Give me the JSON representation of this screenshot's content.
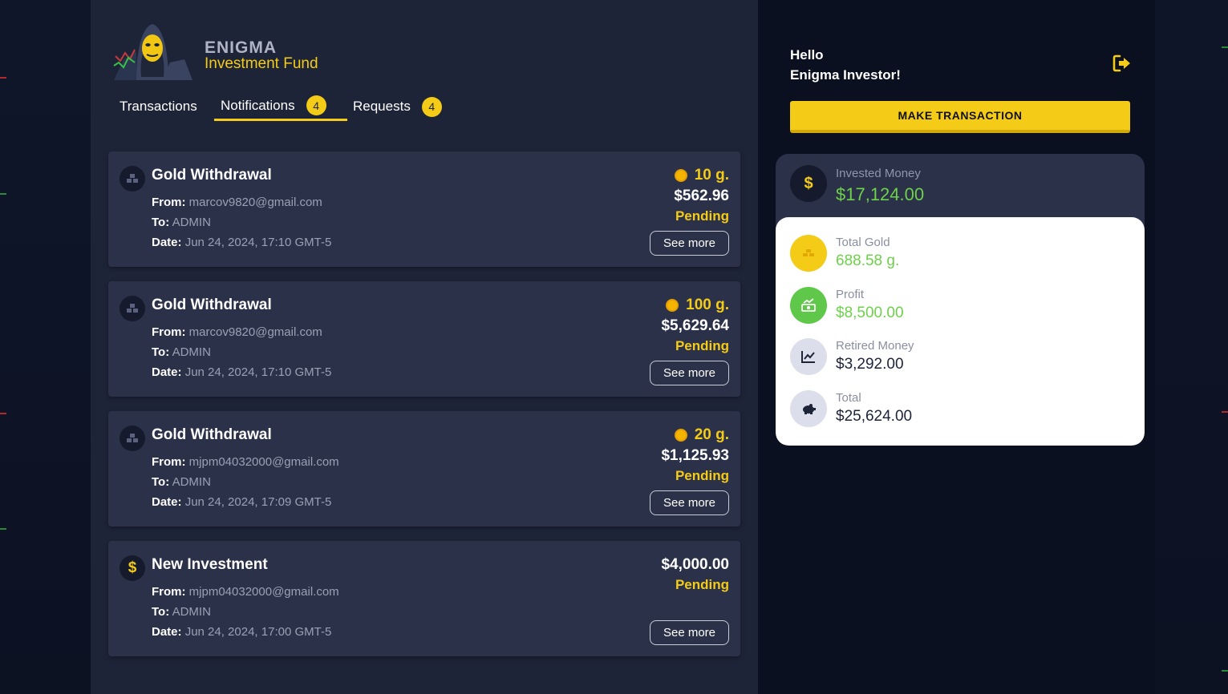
{
  "brand": {
    "line1": "ENIGMA",
    "line2": "Investment Fund"
  },
  "tabs": [
    {
      "label": "Transactions",
      "badge": ""
    },
    {
      "label": "Notifications",
      "badge": "4"
    },
    {
      "label": "Requests",
      "badge": "4"
    }
  ],
  "notifications": [
    {
      "title": "Gold Withdrawal",
      "from_label": "From:",
      "from": "marcov9820@gmail.com",
      "to_label": "To:",
      "to": "ADMIN",
      "date_label": "Date:",
      "date": "Jun 24, 2024, 17:10 GMT-5",
      "grams": "10 g.",
      "amount": "$562.96",
      "status": "Pending",
      "button": "See more"
    },
    {
      "title": "Gold Withdrawal",
      "from_label": "From:",
      "from": "marcov9820@gmail.com",
      "to_label": "To:",
      "to": "ADMIN",
      "date_label": "Date:",
      "date": "Jun 24, 2024, 17:10 GMT-5",
      "grams": "100 g.",
      "amount": "$5,629.64",
      "status": "Pending",
      "button": "See more"
    },
    {
      "title": "Gold Withdrawal",
      "from_label": "From:",
      "from": "mjpm04032000@gmail.com",
      "to_label": "To:",
      "to": "ADMIN",
      "date_label": "Date:",
      "date": "Jun 24, 2024, 17:09 GMT-5",
      "grams": "20 g.",
      "amount": "$1,125.93",
      "status": "Pending",
      "button": "See more"
    },
    {
      "title": "New Investment",
      "from_label": "From:",
      "from": "mjpm04032000@gmail.com",
      "to_label": "To:",
      "to": "ADMIN",
      "date_label": "Date:",
      "date": "Jun 24, 2024, 17:00 GMT-5",
      "amount": "$4,000.00",
      "status": "Pending",
      "button": "See more"
    }
  ],
  "user": {
    "hello": "Hello",
    "name": "Enigma Investor!"
  },
  "make_transaction": "MAKE TRANSACTION",
  "summary": {
    "invested": {
      "label": "Invested Money",
      "value": "$17,124.00"
    },
    "total_gold": {
      "label": "Total Gold",
      "value": "688.58 g."
    },
    "profit": {
      "label": "Profit",
      "value": "$8,500.00"
    },
    "retired": {
      "label": "Retired Money",
      "value": "$3,292.00"
    },
    "total": {
      "label": "Total",
      "value": "$25,624.00"
    }
  },
  "colors": {
    "accent": "#f4cb16",
    "positive": "#6dd14a",
    "panel": "#1e2438",
    "card": "#2b3149",
    "background": "#0b1020"
  },
  "icons": {
    "gold_withdrawal": "gold-bars-icon",
    "new_investment": "dollar-icon",
    "coin": "coin-icon",
    "logout": "logout-icon",
    "invested": "dollar-icon",
    "total_gold": "gold-bars-icon",
    "profit": "money-growth-icon",
    "retired": "chart-line-icon",
    "total": "piggy-bank-icon"
  }
}
